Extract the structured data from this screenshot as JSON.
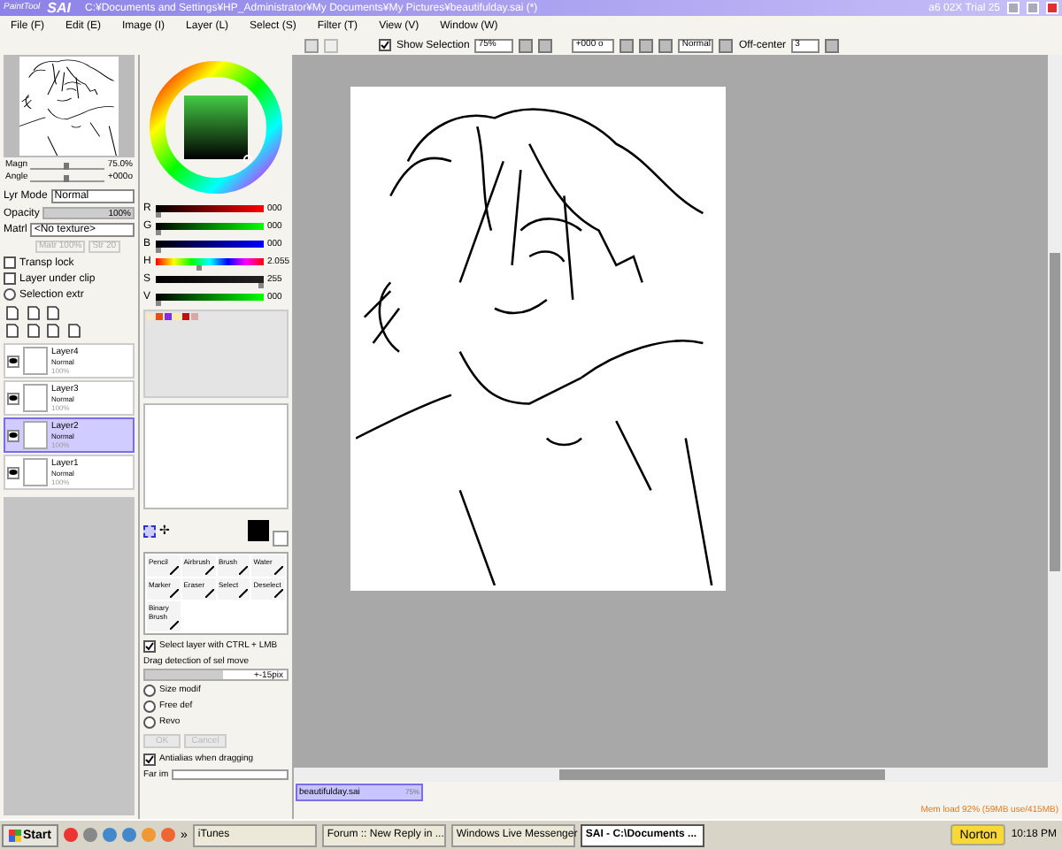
{
  "title_bar": {
    "logo_small": "PaintTool",
    "logo": "SAI",
    "path": "C:¥Documents and Settings¥HP_Administrator¥My Documents¥My Pictures¥beautifulday.sai (*)",
    "info": "a6 02X Trial 25"
  },
  "menu": [
    "File (F)",
    "Edit (E)",
    "Image (I)",
    "Layer (L)",
    "Select (S)",
    "Filter (T)",
    "View (V)",
    "Window (W)"
  ],
  "toolbar": {
    "show_selection": {
      "label": "Show Selection",
      "checked": true
    },
    "zoom": "75%",
    "rotation": "+000 o",
    "blend": "Normal",
    "off_center_label": "Off-center",
    "off_center": "3"
  },
  "navigator": [
    {
      "label": "Magn",
      "value": "75.0%",
      "level": 0.5
    },
    {
      "label": "Angle",
      "value": "+000o",
      "level": 0.5
    }
  ],
  "layer_props": {
    "mode_label": "Lyr Mode",
    "mode": "Normal",
    "opacity": {
      "label": "Opacity",
      "value": "100%",
      "level": 1
    },
    "material_label": "Matrl",
    "material": "<No texture>",
    "material_amount": "Matr 100%",
    "strength": "Str 20",
    "options": [
      {
        "label": "Transp lock",
        "kind": "check",
        "checked": false
      },
      {
        "label": "Layer under clip",
        "kind": "check",
        "checked": false
      },
      {
        "label": "Selection extr",
        "kind": "radio",
        "checked": false
      }
    ]
  },
  "layers": [
    {
      "name": "Layer4",
      "mode": "Normal",
      "opacity": "100%",
      "visible": true,
      "selected": false
    },
    {
      "name": "Layer3",
      "mode": "Normal",
      "opacity": "100%",
      "visible": true,
      "selected": false
    },
    {
      "name": "Layer2",
      "mode": "Normal",
      "opacity": "100%",
      "visible": true,
      "selected": true
    },
    {
      "name": "Layer1",
      "mode": "Normal",
      "opacity": "100%",
      "visible": true,
      "selected": false
    }
  ],
  "color_sliders": [
    {
      "label": "R",
      "value": "000",
      "level": 0,
      "kind": "red"
    },
    {
      "label": "G",
      "value": "000",
      "level": 0,
      "kind": "green"
    },
    {
      "label": "B",
      "value": "000",
      "level": 0,
      "kind": "blue"
    },
    {
      "label": "H",
      "value": "2.055",
      "level": 0.4,
      "kind": "hue"
    },
    {
      "label": "S",
      "value": "255",
      "level": 1,
      "kind": "gray"
    },
    {
      "label": "V",
      "value": "000",
      "level": 0,
      "kind": "green"
    }
  ],
  "swatches": [
    {
      "color": "#f8e8c8"
    },
    {
      "color": "#e85010"
    },
    {
      "color": "#8030e0"
    },
    {
      "color": "#f8f0a0"
    },
    {
      "color": "#c01010"
    },
    {
      "color": "#d8a8a8"
    }
  ],
  "tools": [
    {
      "name": "Pencil",
      "selected": false
    },
    {
      "name": "Airbrush",
      "selected": false
    },
    {
      "name": "Brush",
      "selected": false
    },
    {
      "name": "Water",
      "selected": false
    },
    {
      "name": "Marker",
      "selected": false
    },
    {
      "name": "Eraser",
      "selected": false
    },
    {
      "name": "Select",
      "selected": false
    },
    {
      "name": "Deselect",
      "selected": false
    },
    {
      "name": "Binary Brush",
      "selected": false
    }
  ],
  "tool_options": {
    "select_layer": {
      "label": "Select layer with CTRL + LMB",
      "checked": true
    },
    "drag": {
      "label": "Drag detection of sel move",
      "value": "+-15pix",
      "level": 0.55
    },
    "move_glyph": "✢",
    "modes": [
      {
        "label": "Size modif",
        "selected": false
      },
      {
        "label": "Free def",
        "selected": false
      },
      {
        "label": "Revo",
        "selected": false
      }
    ],
    "ok": "OK",
    "cancel": "Cancel",
    "antialias": {
      "label": "Antialias when dragging",
      "checked": true
    },
    "far_label": "Far im"
  },
  "document_tab": {
    "name": "beautifulday.sai",
    "zoom": "75%"
  },
  "memory": "Mem load 92% (59MB use/415MB)",
  "taskbar": {
    "start": "Start",
    "more": "»",
    "tasks": [
      {
        "label": "iTunes",
        "selected": false
      },
      {
        "label": "Forum :: New Reply in ...",
        "selected": false
      },
      {
        "label": "Windows Live Messenger",
        "selected": false
      },
      {
        "label": "SAI - C:\\Documents ...",
        "selected": true
      }
    ],
    "norton": "Norton",
    "time": "10:18 PM"
  }
}
